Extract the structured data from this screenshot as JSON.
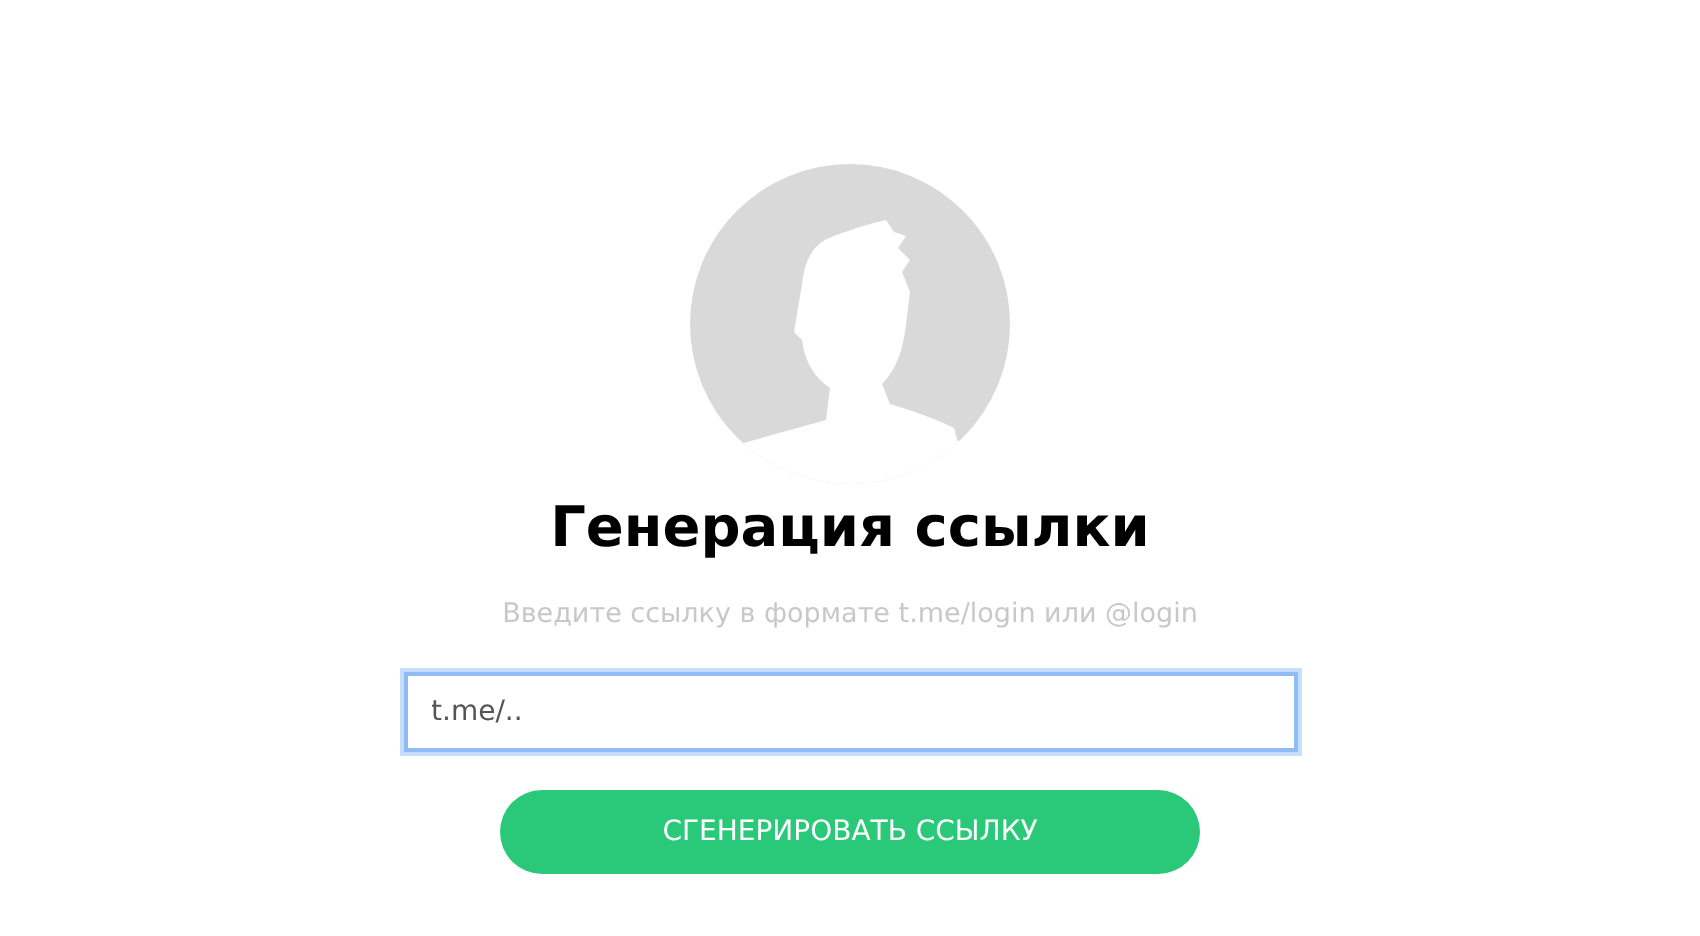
{
  "title": "Генерация ссылки",
  "subtitle": "Введите ссылку в формате t.me/login или @login",
  "link_field": {
    "value": "t.me/..",
    "focused": true
  },
  "button": "СГЕНЕРИРОВАТЬ ССЫЛКУ"
}
